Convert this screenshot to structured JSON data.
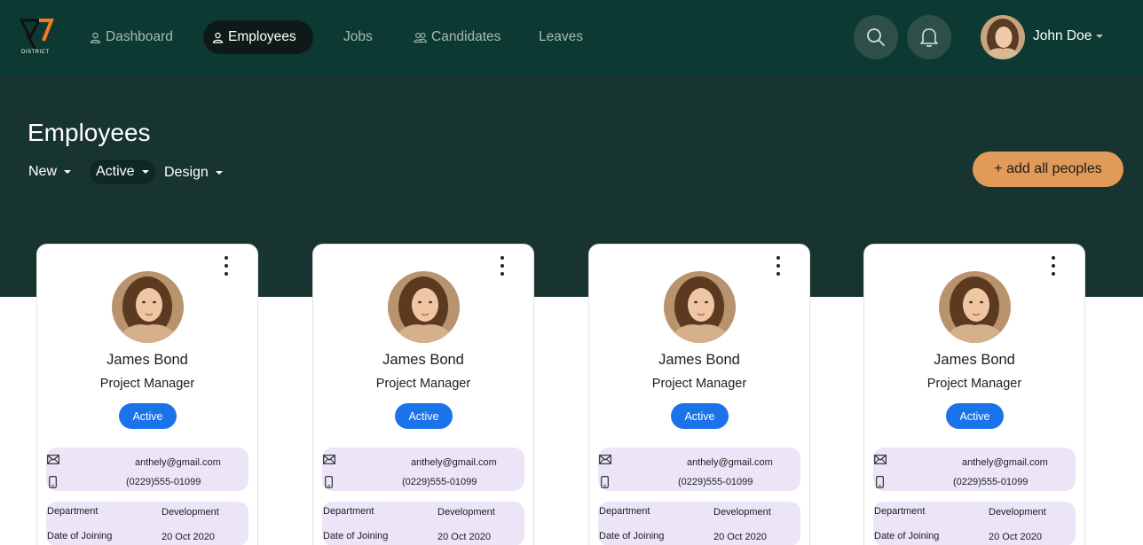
{
  "app": {
    "logo_text": "DISTRICT",
    "logo_mark": "7"
  },
  "nav": {
    "items": [
      {
        "label": "Dashboard",
        "icon": "user-icon",
        "active": false
      },
      {
        "label": "Employees",
        "icon": "user-icon",
        "active": true
      },
      {
        "label": "Jobs",
        "icon": "",
        "active": false
      },
      {
        "label": "Candidates",
        "icon": "users-icon",
        "active": false
      },
      {
        "label": "Leaves",
        "icon": "",
        "active": false
      }
    ],
    "search_icon": "search-icon",
    "notification_icon": "bell-icon"
  },
  "user": {
    "name": "John Doe"
  },
  "page": {
    "title": "Employees",
    "filters": [
      {
        "label": "New"
      },
      {
        "label": "Active"
      },
      {
        "label": "Design"
      }
    ],
    "add_button_label": "+ add all peoples"
  },
  "employees": [
    {
      "name": "James Bond",
      "role": "Project Manager",
      "status": "Active",
      "email": "anthely@gmail.com",
      "phone": "(0229)555-01099",
      "department_label": "Department",
      "department": "Development",
      "joining_label": "Date of Joining",
      "joining_date": "20 Oct 2020"
    },
    {
      "name": "James Bond",
      "role": "Project Manager",
      "status": "Active",
      "email": "anthely@gmail.com",
      "phone": "(0229)555-01099",
      "department_label": "Department",
      "department": "Development",
      "joining_label": "Date of Joining",
      "joining_date": "20 Oct 2020"
    },
    {
      "name": "James Bond",
      "role": "Project Manager",
      "status": "Active",
      "email": "anthely@gmail.com",
      "phone": "(0229)555-01099",
      "department_label": "Department",
      "department": "Development",
      "joining_label": "Date of Joining",
      "joining_date": "20 Oct 2020"
    },
    {
      "name": "James Bond",
      "role": "Project Manager",
      "status": "Active",
      "email": "anthely@gmail.com",
      "phone": "(0229)555-01099",
      "department_label": "Department",
      "department": "Development",
      "joining_label": "Date of Joining",
      "joining_date": "20 Oct 2020"
    }
  ],
  "colors": {
    "topbar": "#0c3a32",
    "hero": "#183430",
    "accent_orange": "#e19a58",
    "status_blue": "#1a73e8",
    "info_box": "#ece5f7"
  }
}
